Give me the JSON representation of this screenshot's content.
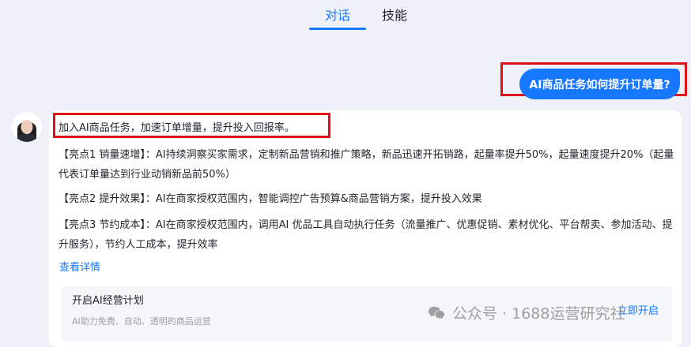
{
  "tabs": {
    "chat": "对话",
    "skills": "技能"
  },
  "user_message": "AI商品任务如何提升订单量?",
  "answer": {
    "headline": "加入AI商品任务，加速订单增量，提升投入回报率。",
    "point1": "【亮点1 销量速增】：AI持续洞察买家需求，定制新品营销和推广策略，新品迅速开拓销路，起量率提升50%，起量速度提升20%（起量代表订单量达到行业动销新品前50%）",
    "point2": "【亮点2 提升效果】：AI在商家授权范围内，智能调控广告预算&商品营销方案，提升投入效果",
    "point3": "【亮点3 节约成本】：AI在商家授权范围内，调用AI 优品工具自动执行任务（流量推广、优惠促销、素材优化、平台帮卖、参加活动、提升服务），节约人工成本，提升效率",
    "details_link": "查看详情"
  },
  "plan_card": {
    "title": "开启AI经营计划",
    "subtitle": "AI助力免费、自动、透明的商品运营",
    "action": "立即开启"
  },
  "watermark": {
    "text": "公众号 · 1688运营研究社",
    "icon": "wechat-icon"
  },
  "colors": {
    "accent": "#1677ff",
    "highlight": "#e0101b",
    "background": "#eef1f8"
  }
}
